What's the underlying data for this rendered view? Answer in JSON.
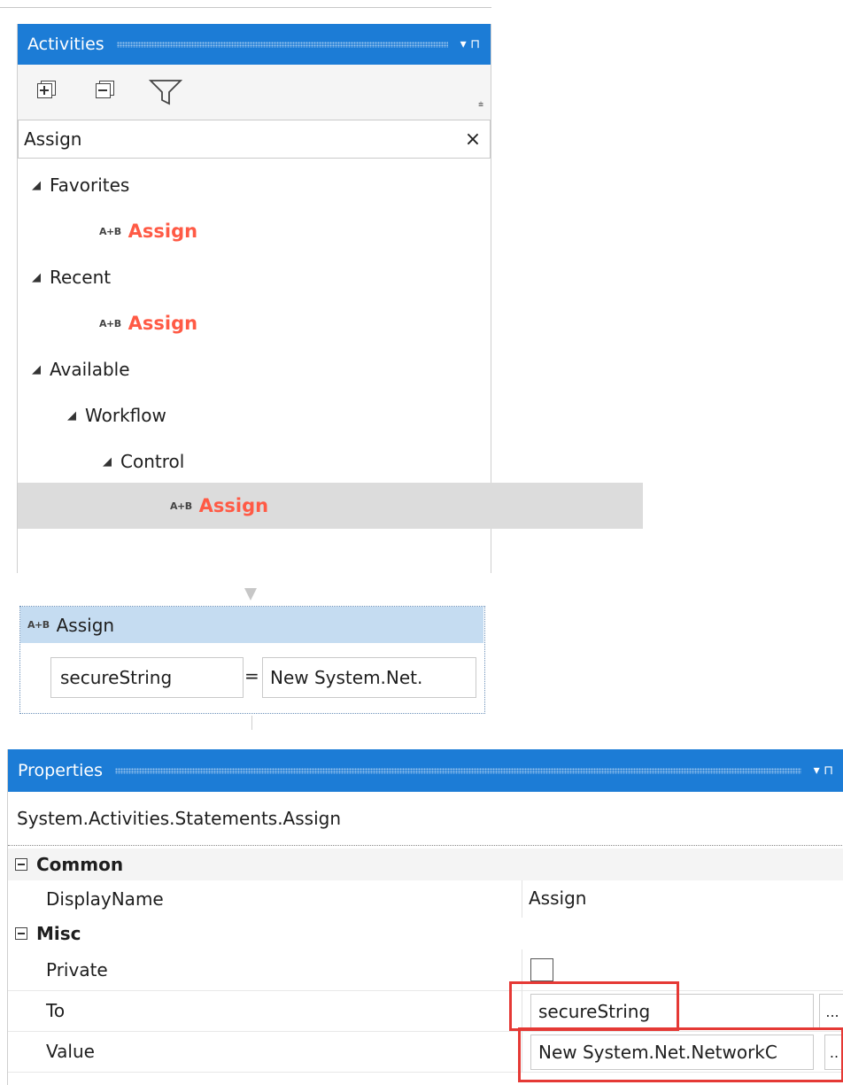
{
  "activities": {
    "title": "Activities",
    "pin_controls": "▾  ⊓",
    "search": {
      "value": "Assign",
      "clear_glyph": "×"
    },
    "tree": [
      {
        "label": "Favorites",
        "type": "group"
      },
      {
        "label": "Assign",
        "type": "item",
        "icon_text": "A+B"
      },
      {
        "label": "Recent",
        "type": "group"
      },
      {
        "label": "Assign",
        "type": "item",
        "icon_text": "A+B"
      },
      {
        "label": "Available",
        "type": "group"
      },
      {
        "label": "Workflow",
        "type": "group"
      },
      {
        "label": "Control",
        "type": "group"
      },
      {
        "label": "Assign",
        "type": "item",
        "icon_text": "A+B",
        "selected": true
      }
    ]
  },
  "designer": {
    "assign": {
      "icon_text": "A+B",
      "title": "Assign",
      "to_value": "secureString",
      "equals": "=",
      "value_expr": "New System.Net."
    }
  },
  "properties": {
    "title": "Properties",
    "pin_controls": "▾  ⊓",
    "type_name": "System.Activities.Statements.Assign",
    "categories": {
      "common": "Common",
      "misc": "Misc"
    },
    "rows": {
      "display_name": {
        "label": "DisplayName",
        "value": "Assign"
      },
      "private": {
        "label": "Private",
        "checked": false
      },
      "to": {
        "label": "To",
        "value": "secureString",
        "ellipsis": "..."
      },
      "value": {
        "label": "Value",
        "value": "New System.Net.NetworkC",
        "ellipsis": ".."
      }
    },
    "highlight_color": "#e53935"
  },
  "colors": {
    "accent": "#1c7cd6",
    "search_hit": "#ff5a45",
    "assign_header": "#c5dcf1"
  }
}
